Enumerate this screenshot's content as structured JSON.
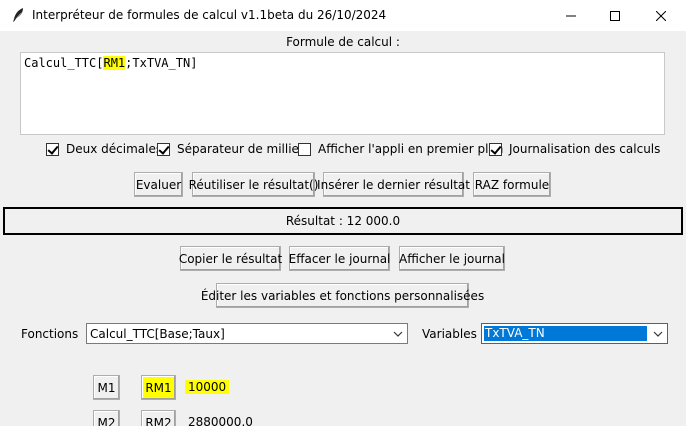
{
  "window": {
    "title": "Interpréteur de formules de calcul v1.1beta du 26/10/2024",
    "controls": [
      "minimize-icon",
      "maximize-icon",
      "close-icon"
    ]
  },
  "formula": {
    "label": "Formule de calcul :",
    "text_before": "Calcul_TTC[",
    "text_highlight": "RM1",
    "text_after": ";TxTVA_TN]",
    "highlight_color": "#ffff00"
  },
  "options": [
    {
      "label": "Deux décimales",
      "checked": true
    },
    {
      "label": "Séparateur de milliers",
      "checked": true
    },
    {
      "label": "Afficher l'appli en premier plan",
      "checked": false
    },
    {
      "label": "Journalisation des calculs",
      "checked": true
    }
  ],
  "actions": {
    "evaluate": "Evaluer",
    "reuse": "Réutiliser le résultat()",
    "insert_last": "Insérer le dernier résultat",
    "reset": "RAZ formule"
  },
  "result": {
    "text": "Résultat : 12 000.0"
  },
  "journal": {
    "copy": "Copier le résultat",
    "clear": "Effacer le journal",
    "show": "Afficher le journal"
  },
  "edit_button": "Éditer les variables et fonctions personnalisées",
  "selectors": {
    "functions_label": "Fonctions",
    "functions_value": "Calcul_TTC[Base;Taux]",
    "variables_label": "Variables",
    "variables_value": "TxTVA_TN",
    "selection_color": "#0078d7"
  },
  "memories": [
    {
      "m_label": "M1",
      "rm_label": "RM1",
      "value": "10000",
      "highlighted": true
    },
    {
      "m_label": "M2",
      "rm_label": "RM2",
      "value": "2880000.0",
      "highlighted": false
    }
  ]
}
